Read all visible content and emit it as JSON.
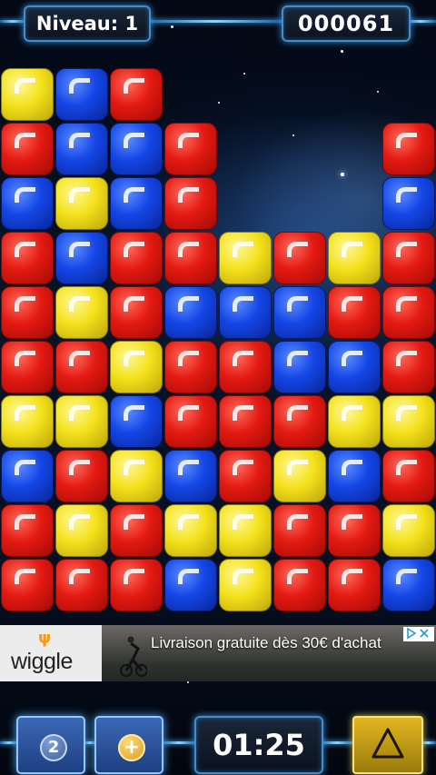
{
  "hud": {
    "level_label": "Niveau: 1",
    "score": "000061"
  },
  "board": {
    "columns": 8,
    "rows": 10,
    "cells": [
      [
        "yellow",
        "blue",
        "red",
        null,
        null,
        null,
        null,
        null
      ],
      [
        "red",
        "blue",
        "blue",
        "red",
        null,
        null,
        null,
        "red"
      ],
      [
        "blue",
        "yellow",
        "blue",
        "red",
        null,
        null,
        null,
        "blue"
      ],
      [
        "red",
        "blue",
        "red",
        "red",
        "yellow",
        "red",
        "yellow",
        "red"
      ],
      [
        "red",
        "yellow",
        "red",
        "blue",
        "blue",
        "blue",
        "red",
        "red"
      ],
      [
        "red",
        "red",
        "yellow",
        "red",
        "red",
        "blue",
        "blue",
        "red"
      ],
      [
        "yellow",
        "yellow",
        "blue",
        "red",
        "red",
        "red",
        "yellow",
        "yellow"
      ],
      [
        "blue",
        "red",
        "yellow",
        "blue",
        "red",
        "yellow",
        "blue",
        "red"
      ],
      [
        "red",
        "yellow",
        "red",
        "yellow",
        "yellow",
        "red",
        "red",
        "yellow"
      ],
      [
        "red",
        "red",
        "red",
        "blue",
        "yellow",
        "red",
        "red",
        "blue"
      ]
    ]
  },
  "ad": {
    "brand": "wiggle",
    "text": "Livraison gratuite dès 30€ d'achat",
    "choices_icon": "adchoices-icon"
  },
  "controls": {
    "hint_count": "2",
    "add_label": "+",
    "timer": "01:25",
    "warning_icon": "triangle-icon"
  },
  "colors": {
    "red": "#e31a12",
    "blue": "#1446e6",
    "yellow": "#f4e21b",
    "hud_glow": "#4ab3ff"
  }
}
